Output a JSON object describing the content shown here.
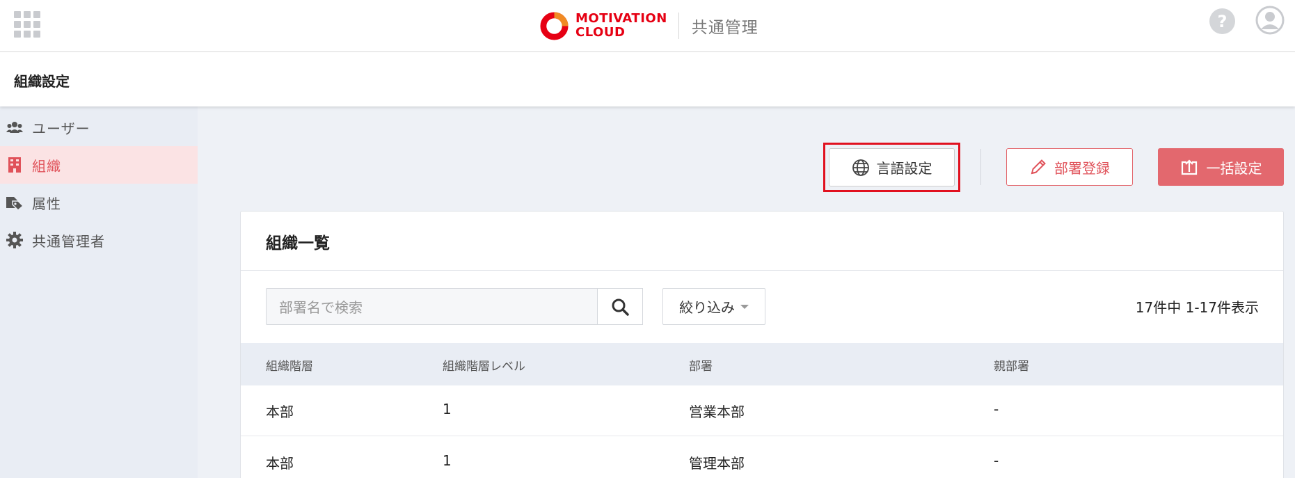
{
  "header": {
    "brand_line1": "MOTIVATION",
    "brand_line2": "CLOUD",
    "app_name": "共通管理",
    "help_glyph": "?",
    "brand_color": "#e60013"
  },
  "page": {
    "title": "組織設定"
  },
  "sidebar": {
    "items": [
      {
        "label": "ユーザー",
        "icon": "users-icon",
        "active": false
      },
      {
        "label": "組織",
        "icon": "building-icon",
        "active": true
      },
      {
        "label": "属性",
        "icon": "tags-icon",
        "active": false
      },
      {
        "label": "共通管理者",
        "icon": "gear-icon",
        "active": false
      }
    ]
  },
  "toolbar": {
    "language_label": "言語設定",
    "register_dept_label": "部署登録",
    "bulk_setting_label": "一括設定",
    "accent_color": "#e3686e",
    "highlight_color": "#e1111f"
  },
  "panel": {
    "title": "組織一覧",
    "search_placeholder": "部署名で検索",
    "filter_label": "絞り込み",
    "count_text": "17件中 1-17件表示",
    "columns": [
      "組織階層",
      "組織階層レベル",
      "部署",
      "親部署"
    ],
    "rows": [
      [
        "本部",
        "1",
        "営業本部",
        "-"
      ],
      [
        "本部",
        "1",
        "管理本部",
        "-"
      ]
    ]
  }
}
